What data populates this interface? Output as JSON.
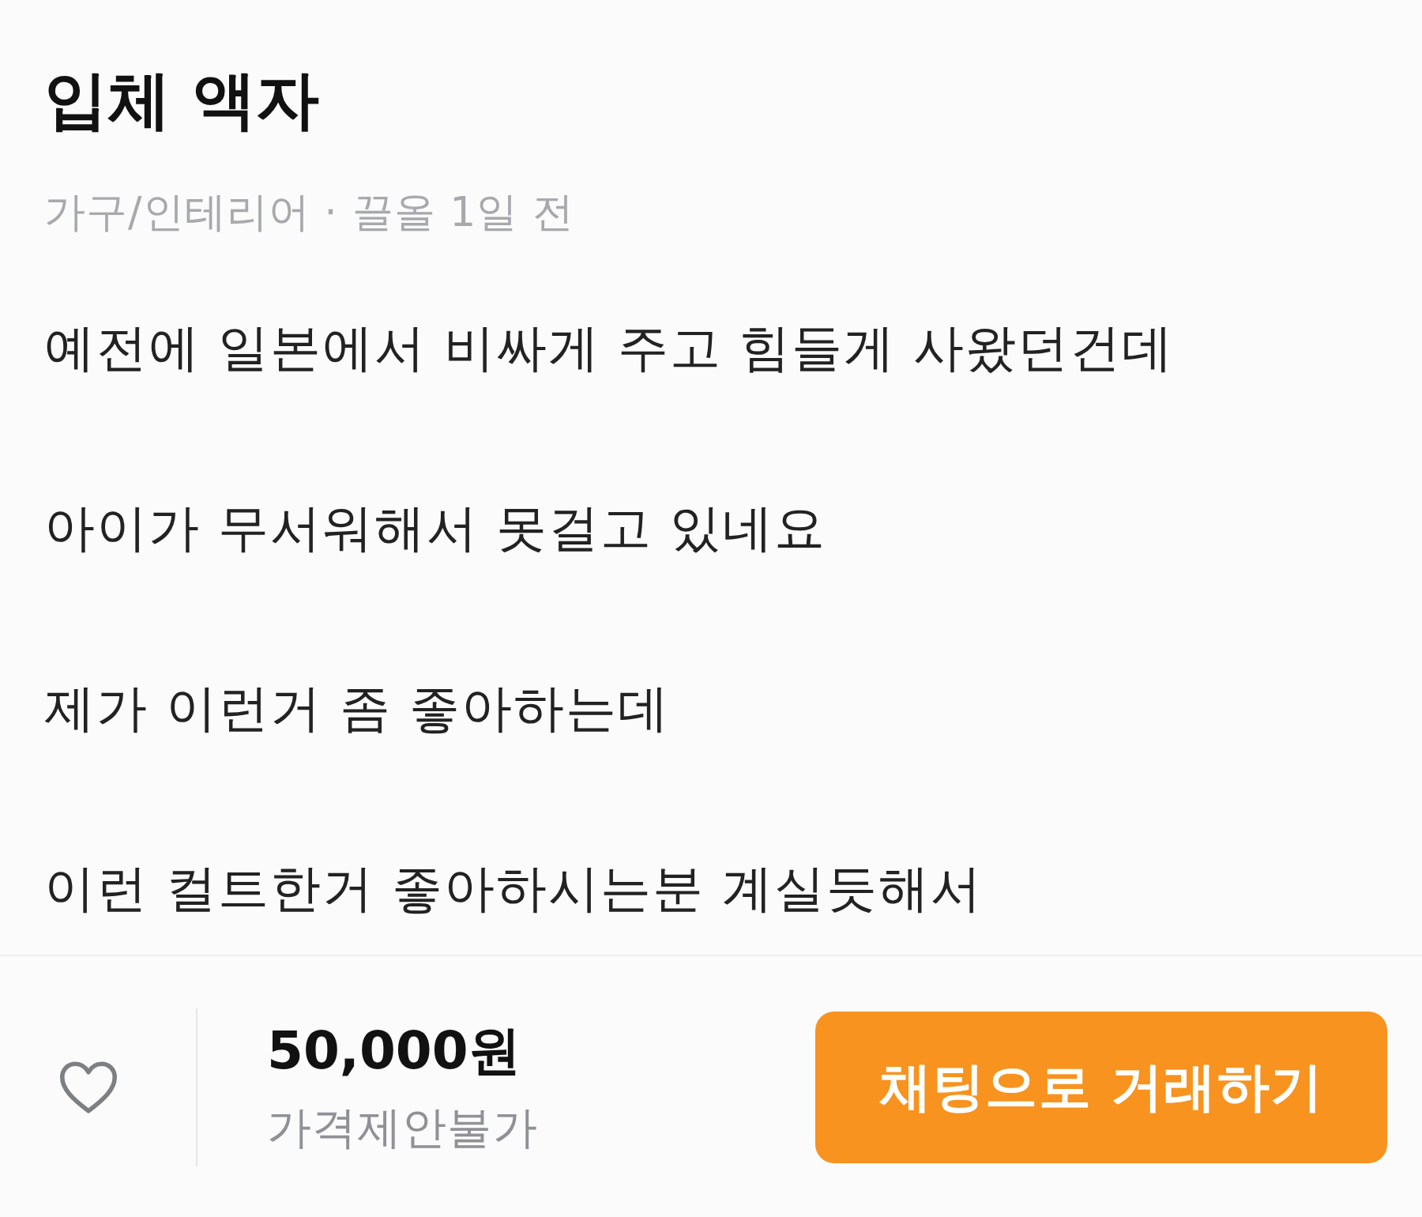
{
  "listing": {
    "title": "입체 액자",
    "meta": "가구/인테리어 · 끌올 1일 전",
    "description": [
      "예전에 일본에서 비싸게 주고 힘들게 사왔던건데",
      "아이가 무서워해서 못걸고 있네요",
      "제가 이런거 좀 좋아하는데",
      "이런 컬트한거 좋아하시는분 계실듯해서"
    ]
  },
  "bottom_bar": {
    "favorited": false,
    "price": "50,000원",
    "price_note": "가격제안불가",
    "chat_button": "채팅으로 거래하기"
  }
}
